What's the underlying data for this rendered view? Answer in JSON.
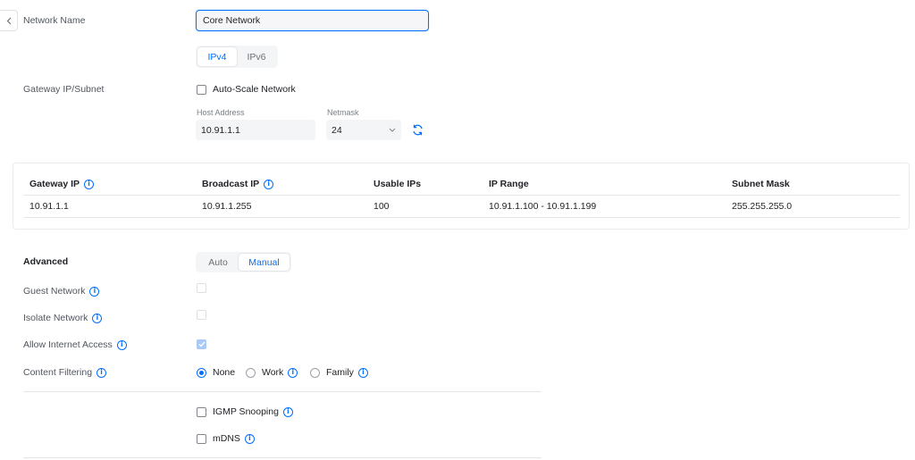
{
  "network_name": {
    "label": "Network Name",
    "value": "Core Network"
  },
  "ip_version": {
    "options": [
      "IPv4",
      "IPv6"
    ],
    "selected": "IPv4"
  },
  "gateway": {
    "label": "Gateway IP/Subnet",
    "auto_scale_label": "Auto-Scale Network",
    "auto_scale_checked": false,
    "host_address_label": "Host Address",
    "host_address_value": "10.91.1.1",
    "netmask_label": "Netmask",
    "netmask_value": "24"
  },
  "subnet_table": {
    "headers": [
      "Gateway IP",
      "Broadcast IP",
      "Usable IPs",
      "IP Range",
      "Subnet Mask"
    ],
    "row": [
      "10.91.1.1",
      "10.91.1.255",
      "100",
      "10.91.1.100 - 10.91.1.199",
      "255.255.255.0"
    ]
  },
  "advanced": {
    "label": "Advanced",
    "options": [
      "Auto",
      "Manual"
    ],
    "selected": "Manual"
  },
  "guest_network": {
    "label": "Guest Network",
    "checked": false
  },
  "isolate_network": {
    "label": "Isolate Network",
    "checked": false
  },
  "allow_internet": {
    "label": "Allow Internet Access",
    "checked": true
  },
  "content_filtering": {
    "label": "Content Filtering",
    "options": [
      "None",
      "Work",
      "Family"
    ],
    "selected": "None"
  },
  "igmp_snooping": {
    "label": "IGMP Snooping",
    "checked": false
  },
  "mdns": {
    "label": "mDNS",
    "checked": false
  },
  "colors": {
    "accent": "#006fff",
    "label_text": "#50565e",
    "border": "#e3e5e8"
  },
  "icons": {
    "back": "chevron-left-icon",
    "info": "info-icon",
    "refresh": "refresh-icon",
    "dropdown": "chevron-down-icon"
  }
}
